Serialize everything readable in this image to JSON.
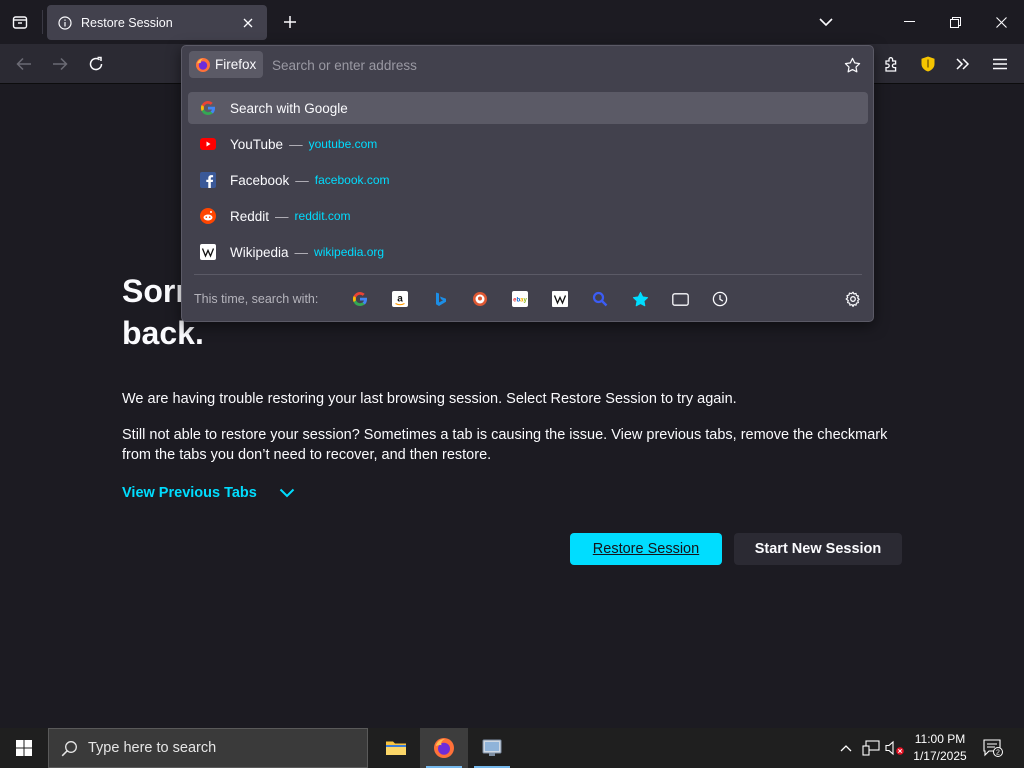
{
  "tab": {
    "title": "Restore Session"
  },
  "urlbar": {
    "identity_label": "Firefox",
    "placeholder": "Search or enter address",
    "suggestions": [
      {
        "title": "Search with Google",
        "url": "",
        "icon": "google-icon"
      },
      {
        "title": "YouTube",
        "sep": "—",
        "url": "youtube.com",
        "icon": "youtube-icon"
      },
      {
        "title": "Facebook",
        "sep": "—",
        "url": "facebook.com",
        "icon": "facebook-icon"
      },
      {
        "title": "Reddit",
        "sep": "—",
        "url": "reddit.com",
        "icon": "reddit-icon"
      },
      {
        "title": "Wikipedia",
        "sep": "—",
        "url": "wikipedia.org",
        "icon": "wikipedia-icon"
      }
    ],
    "oneoff_label": "This time, search with:"
  },
  "content": {
    "title": "Sorry. We’re having trouble getting your pages back.",
    "para1": "We are having trouble restoring your last browsing session. Select Restore Session to try again.",
    "para2": "Still not able to restore your session? Sometimes a tab is causing the issue. View previous tabs, remove the checkmark from the tabs you don’t need to recover, and then restore.",
    "view_previous": "View Previous Tabs",
    "restore_button": "Restore Session",
    "new_session_button": "Start New Session"
  },
  "taskbar": {
    "search_placeholder": "Type here to search",
    "time": "11:00 PM",
    "date": "1/17/2025",
    "notification_count": "2"
  },
  "colors": {
    "accent": "#00ddff",
    "background": "#1c1b22",
    "toolbar": "#2b2a33",
    "panel": "#42414d"
  }
}
